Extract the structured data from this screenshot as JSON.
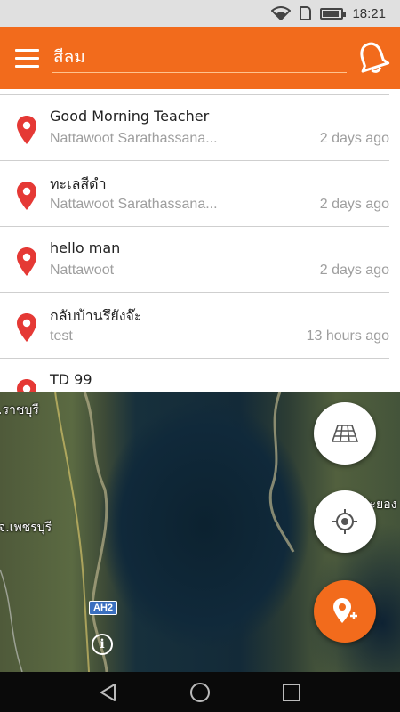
{
  "status_bar": {
    "time": "18:21"
  },
  "app_bar": {
    "search_value": "สีลม",
    "menu_icon": "hamburger-menu-icon",
    "bell_icon": "bell-icon"
  },
  "locations": [
    {
      "title": "Good Morning Teacher",
      "subtitle": "Nattawoot Sarathassana...",
      "time": "2 days ago"
    },
    {
      "title": "ทะเลสีดำ",
      "subtitle": "Nattawoot Sarathassana...",
      "time": "2 days ago"
    },
    {
      "title": "hello man",
      "subtitle": "Nattawoot",
      "time": "2 days ago"
    },
    {
      "title": "กลับบ้านรึยังจ๊ะ",
      "subtitle": "test",
      "time": "13 hours ago"
    },
    {
      "title": "TD 99",
      "subtitle": "",
      "time": ""
    }
  ],
  "map": {
    "labels": {
      "ratchaburi": ".ราชบุรี",
      "phetchaburi": "จ.เพชรบุรี",
      "rayong": "ระยอง"
    },
    "route_badge": "AH2",
    "info_label": "i"
  },
  "colors": {
    "accent": "#f26b1c",
    "pin": "#e53935",
    "divider": "#cfcfcf"
  }
}
